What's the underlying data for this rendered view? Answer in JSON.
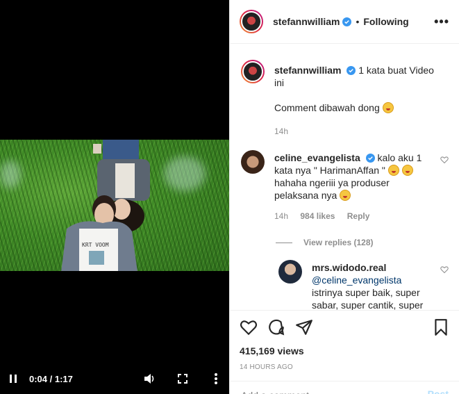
{
  "video": {
    "time": "0:04 / 1:17",
    "shirt_text": "KRT VOOM"
  },
  "header": {
    "username": "stefannwilliam",
    "separator": "•",
    "follow_label": "Following",
    "more_label": "•••"
  },
  "caption": {
    "username": "stefannwilliam",
    "text_line1": "1 kata buat Video",
    "text_line2": "ini",
    "text_line3": "Comment dibawah dong",
    "time": "14h"
  },
  "comment1": {
    "username": "celine_evangelista",
    "text_a": "kalo aku 1",
    "text_b": "kata nya \" HarimanAffan \"",
    "text_c": "hahaha ngeriii ya produser",
    "text_d": "pelaksana nya",
    "time": "14h",
    "likes": "984 likes",
    "reply_label": "Reply",
    "view_replies": "View replies (128)"
  },
  "reply1": {
    "username": "mrs.widodo.real",
    "mention": "@celine_evangelista",
    "line1": "istrinya super baik, super",
    "line2": "sabar, super cantik, super"
  },
  "stats": {
    "views": "415,169 views",
    "date": "14 HOURS AGO"
  },
  "add_comment": {
    "placeholder": "Add a comment...",
    "post_label": "Post"
  },
  "colors": {
    "verified": "#3897f0",
    "muted": "#8e8e8e",
    "link": "#00376b"
  }
}
